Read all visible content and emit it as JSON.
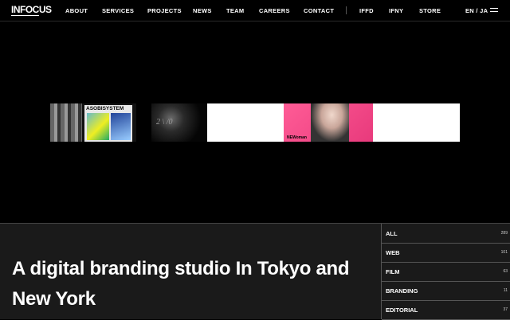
{
  "brand": {
    "logo": "INFOCUS"
  },
  "nav": {
    "items": [
      "ABOUT",
      "SERVICES",
      "PROJECTS",
      "NEWS",
      "TEAM",
      "CAREERS",
      "CONTACT"
    ],
    "secondary": [
      "IFFD",
      "IFNY",
      "STORE"
    ],
    "lang": "EN / JA"
  },
  "hero": {
    "thumbs": [
      {
        "label": "ASOBISYSTEM"
      },
      {
        "label": "2 \\ /0"
      },
      {
        "label": "NEWoman"
      }
    ]
  },
  "main": {
    "headline": "A digital branding studio In Tokyo and New York"
  },
  "categories": [
    {
      "name": "ALL",
      "count": "289"
    },
    {
      "name": "WEB",
      "count": "101"
    },
    {
      "name": "FILM",
      "count": "63"
    },
    {
      "name": "BRANDING",
      "count": "11"
    },
    {
      "name": "EDITORIAL",
      "count": "37"
    }
  ],
  "colors": {
    "background": "#000000",
    "panel": "#1a1a1a",
    "text": "#ffffff",
    "accent": "#e83a7c"
  }
}
